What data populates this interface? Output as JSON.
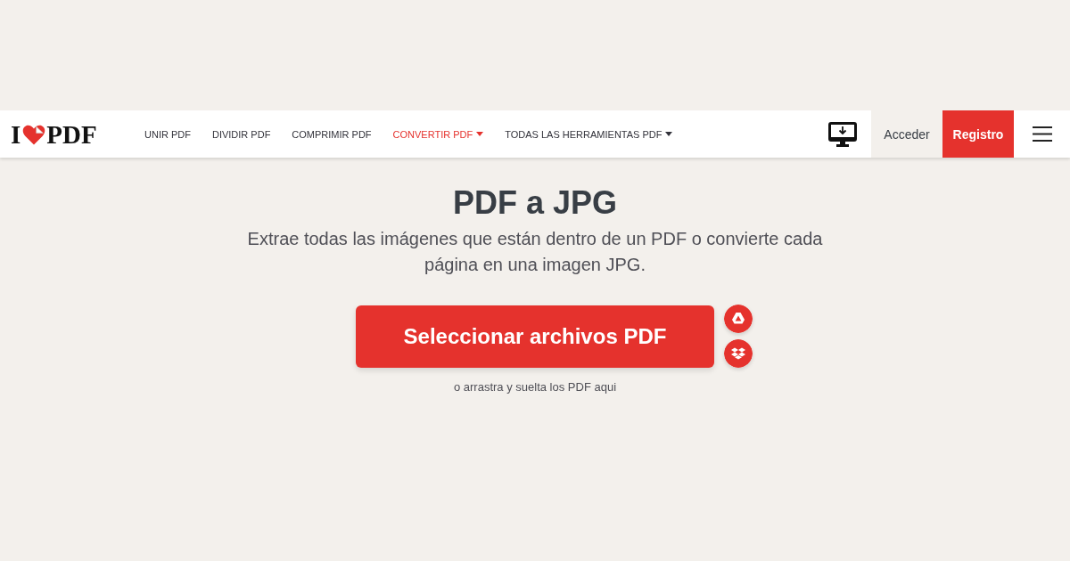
{
  "logo": {
    "text_before": "I",
    "text_after": "PDF"
  },
  "nav": [
    {
      "label": "UNIR PDF",
      "selected": false,
      "dropdown": false
    },
    {
      "label": "DIVIDIR PDF",
      "selected": false,
      "dropdown": false
    },
    {
      "label": "COMPRIMIR PDF",
      "selected": false,
      "dropdown": false
    },
    {
      "label": "CONVERTIR PDF",
      "selected": true,
      "dropdown": true
    },
    {
      "label": "TODAS LAS HERRAMIENTAS PDF",
      "selected": false,
      "dropdown": true
    }
  ],
  "account_buttons": [
    {
      "label": "Acceder",
      "kind": "login"
    },
    {
      "label": "Registro",
      "kind": "signup"
    }
  ],
  "hero": {
    "title": "PDF a JPG",
    "description": "Extrae todas las imágenes que están dentro de un PDF o convierte cada página en una imagen JPG.",
    "upload_button": "Seleccionar archivos PDF",
    "cloud_sources": [
      {
        "kind": "drive"
      },
      {
        "kind": "dropbox"
      }
    ],
    "drop_hint": "o arrastra y suelta los PDF aqui"
  }
}
